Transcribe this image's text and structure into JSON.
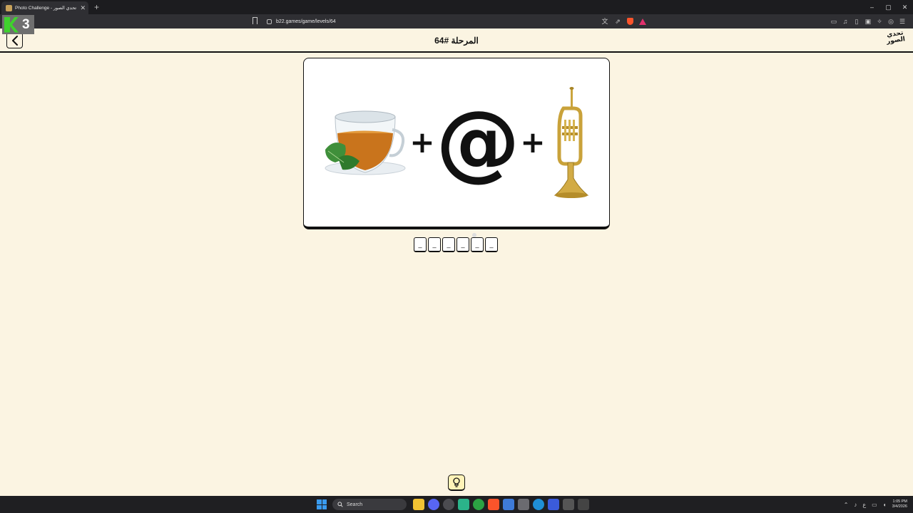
{
  "browser": {
    "tab_title": "Photo Challenge - تحدي الصور",
    "new_tab": "+",
    "url": "b22.games/game/levels/64",
    "window_controls": [
      "–",
      "▢",
      "✕"
    ]
  },
  "overlay": {
    "badge_number": "3"
  },
  "header": {
    "title": "المرحلة #64",
    "logo_line1": "تحدي",
    "logo_line2": "الصور",
    "back_icon": "chevron-left-icon"
  },
  "puzzle": {
    "images": [
      "tea-cup-with-mint",
      "at-sign",
      "trumpet"
    ],
    "plus": "+",
    "at_symbol": "@"
  },
  "answer": {
    "slots": [
      "_",
      "_",
      "_",
      "_",
      "_",
      "_"
    ]
  },
  "hint": {
    "icon": "lightbulb-icon"
  },
  "taskbar": {
    "search_label": "Search",
    "time": "1:05 PM",
    "date": "3/4/2026",
    "lang": "ع"
  },
  "colors": {
    "page_bg": "#fbf4e2",
    "card_bg": "#ffffff",
    "border": "#111111",
    "hint_bg": "#fff3b8",
    "trumpet": "#c9a23a",
    "tea": "#c9741c"
  }
}
